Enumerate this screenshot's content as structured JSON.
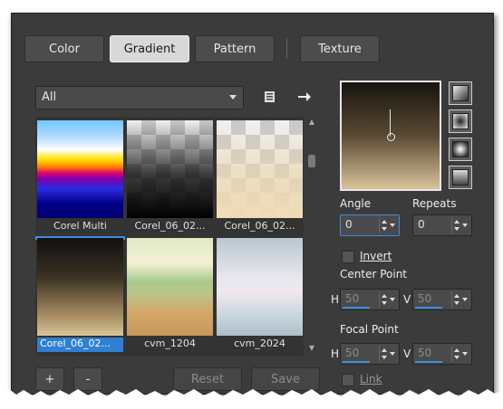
{
  "tabs": [
    {
      "label": "Color",
      "active": false
    },
    {
      "label": "Gradient",
      "active": true
    },
    {
      "label": "Pattern",
      "active": false
    },
    {
      "label": "Texture",
      "active": false
    }
  ],
  "filter": {
    "selected": "All"
  },
  "toolbar_icons": [
    "library-icon",
    "arrow-right-icon"
  ],
  "swatches": [
    {
      "label": "Corel Multi"
    },
    {
      "label": "Corel_06_02..."
    },
    {
      "label": "Corel_06_02..."
    },
    {
      "label": "Corel_06_02...",
      "selected": true
    },
    {
      "label": "cvm_1204"
    },
    {
      "label": "cvm_2024"
    }
  ],
  "buttons": {
    "add": "+",
    "remove": "-",
    "reset": "Reset",
    "save": "Save"
  },
  "angle": {
    "label": "Angle",
    "value": "0"
  },
  "repeats": {
    "label": "Repeats",
    "value": "0"
  },
  "invert": {
    "label": "Invert",
    "checked": false
  },
  "center_point": {
    "label": "Center Point",
    "h_label": "H",
    "h_value": "50",
    "v_label": "V",
    "v_value": "50"
  },
  "focal_point": {
    "label": "Focal Point",
    "h_label": "H",
    "h_value": "50",
    "v_label": "V",
    "v_value": "50"
  },
  "link": {
    "label": "Link",
    "checked": false
  },
  "colors": {
    "accent": "#3a8fe2",
    "panel": "#3b3b3b",
    "gradient_dark": "#17140f",
    "gradient_light": "#d9c49a"
  }
}
